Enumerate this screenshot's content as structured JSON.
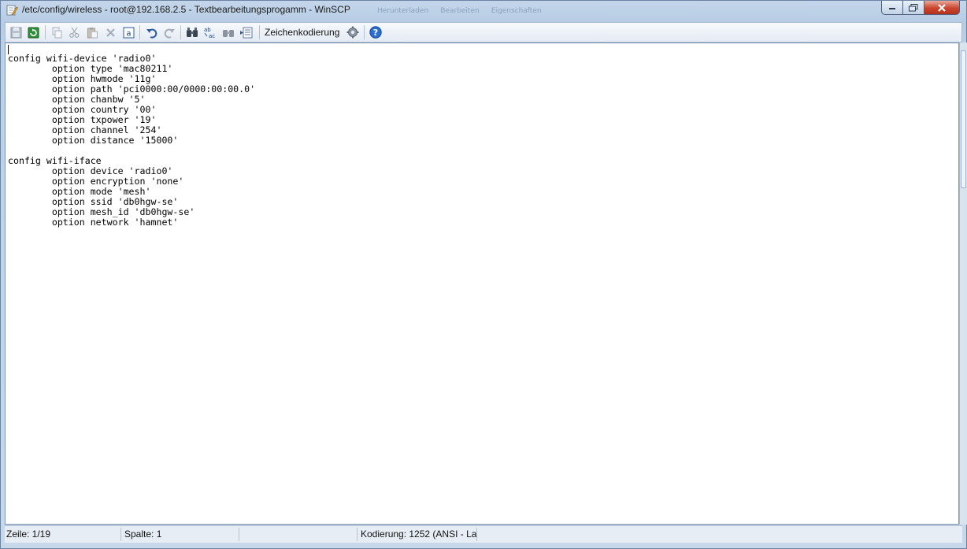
{
  "window": {
    "title": "/etc/config/wireless - root@192.168.2.5 - Textbearbeitungsprogamm - WinSCP",
    "background_apps": [
      "Herunterladen",
      "Bearbeiten",
      "Eigenschaften"
    ]
  },
  "toolbar": {
    "items": [
      {
        "name": "save-icon",
        "icon": "floppy"
      },
      {
        "name": "refresh-icon",
        "icon": "reload"
      },
      {
        "name": "copy-icon",
        "icon": "copy"
      },
      {
        "name": "cut-icon",
        "icon": "scissors"
      },
      {
        "name": "paste-icon",
        "icon": "clipboard"
      },
      {
        "name": "delete-icon",
        "icon": "x"
      },
      {
        "name": "select-all-icon",
        "icon": "a-box"
      },
      {
        "name": "undo-icon",
        "icon": "undo"
      },
      {
        "name": "redo-icon",
        "icon": "redo"
      },
      {
        "name": "find-icon",
        "icon": "binoculars"
      },
      {
        "name": "replace-icon",
        "icon": "ab-ac"
      },
      {
        "name": "find-next-icon",
        "icon": "binoculars-next"
      },
      {
        "name": "goto-line-icon",
        "icon": "list"
      }
    ],
    "encoding_label": "Zeichenkodierung",
    "settings_icon": "gear-icon",
    "help_icon": "help-icon"
  },
  "editor": {
    "text": "config wifi-device 'radio0'\n        option type 'mac80211'\n        option hwmode '11g'\n        option path 'pci0000:00/0000:00:00.0'\n        option chanbw '5'\n        option country '00'\n        option txpower '19'\n        option channel '254'\n        option distance '15000'\n\nconfig wifi-iface\n        option device 'radio0'\n        option encryption 'none'\n        option mode 'mesh'\n        option ssid 'db0hgw-se'\n        option mesh_id 'db0hgw-se'\n        option network 'hamnet'"
  },
  "status": {
    "line": "Zeile: 1/19",
    "column": "Spalte: 1",
    "empty": "",
    "encoding": "Kodierung: 1252  (ANSI - La"
  },
  "colors": {
    "titlebar": "#c4d6ea",
    "close_button": "#c9452f",
    "help_blue": "#2a6fd0",
    "refresh_green": "#2f8f3a"
  }
}
